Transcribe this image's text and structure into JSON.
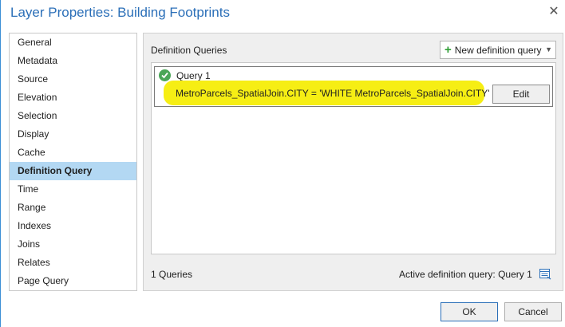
{
  "window": {
    "title": "Layer Properties: Building Footprints",
    "close_glyph": "✕"
  },
  "sidebar": {
    "items": [
      {
        "label": "General"
      },
      {
        "label": "Metadata"
      },
      {
        "label": "Source"
      },
      {
        "label": "Elevation"
      },
      {
        "label": "Selection"
      },
      {
        "label": "Display"
      },
      {
        "label": "Cache"
      },
      {
        "label": "Definition Query",
        "active": true
      },
      {
        "label": "Time"
      },
      {
        "label": "Range"
      },
      {
        "label": "Indexes"
      },
      {
        "label": "Joins"
      },
      {
        "label": "Relates"
      },
      {
        "label": "Page Query"
      }
    ]
  },
  "panel": {
    "title": "Definition Queries",
    "new_query_label": "New definition query",
    "queries": [
      {
        "name": "Query 1",
        "expression": "MetroParcels_SpatialJoin.CITY = 'WHITE MetroParcels_SpatialJoin.CITY'",
        "edit_label": "Edit",
        "status_icon": "check-circle-icon"
      }
    ],
    "count_text": "1 Queries",
    "active_text": "Active definition query: Query 1"
  },
  "footer": {
    "ok_label": "OK",
    "cancel_label": "Cancel"
  },
  "colors": {
    "accent": "#2b6fb8",
    "selected_nav": "#b3d8f3",
    "highlight": "#f6ee14",
    "success": "#4aa657"
  }
}
